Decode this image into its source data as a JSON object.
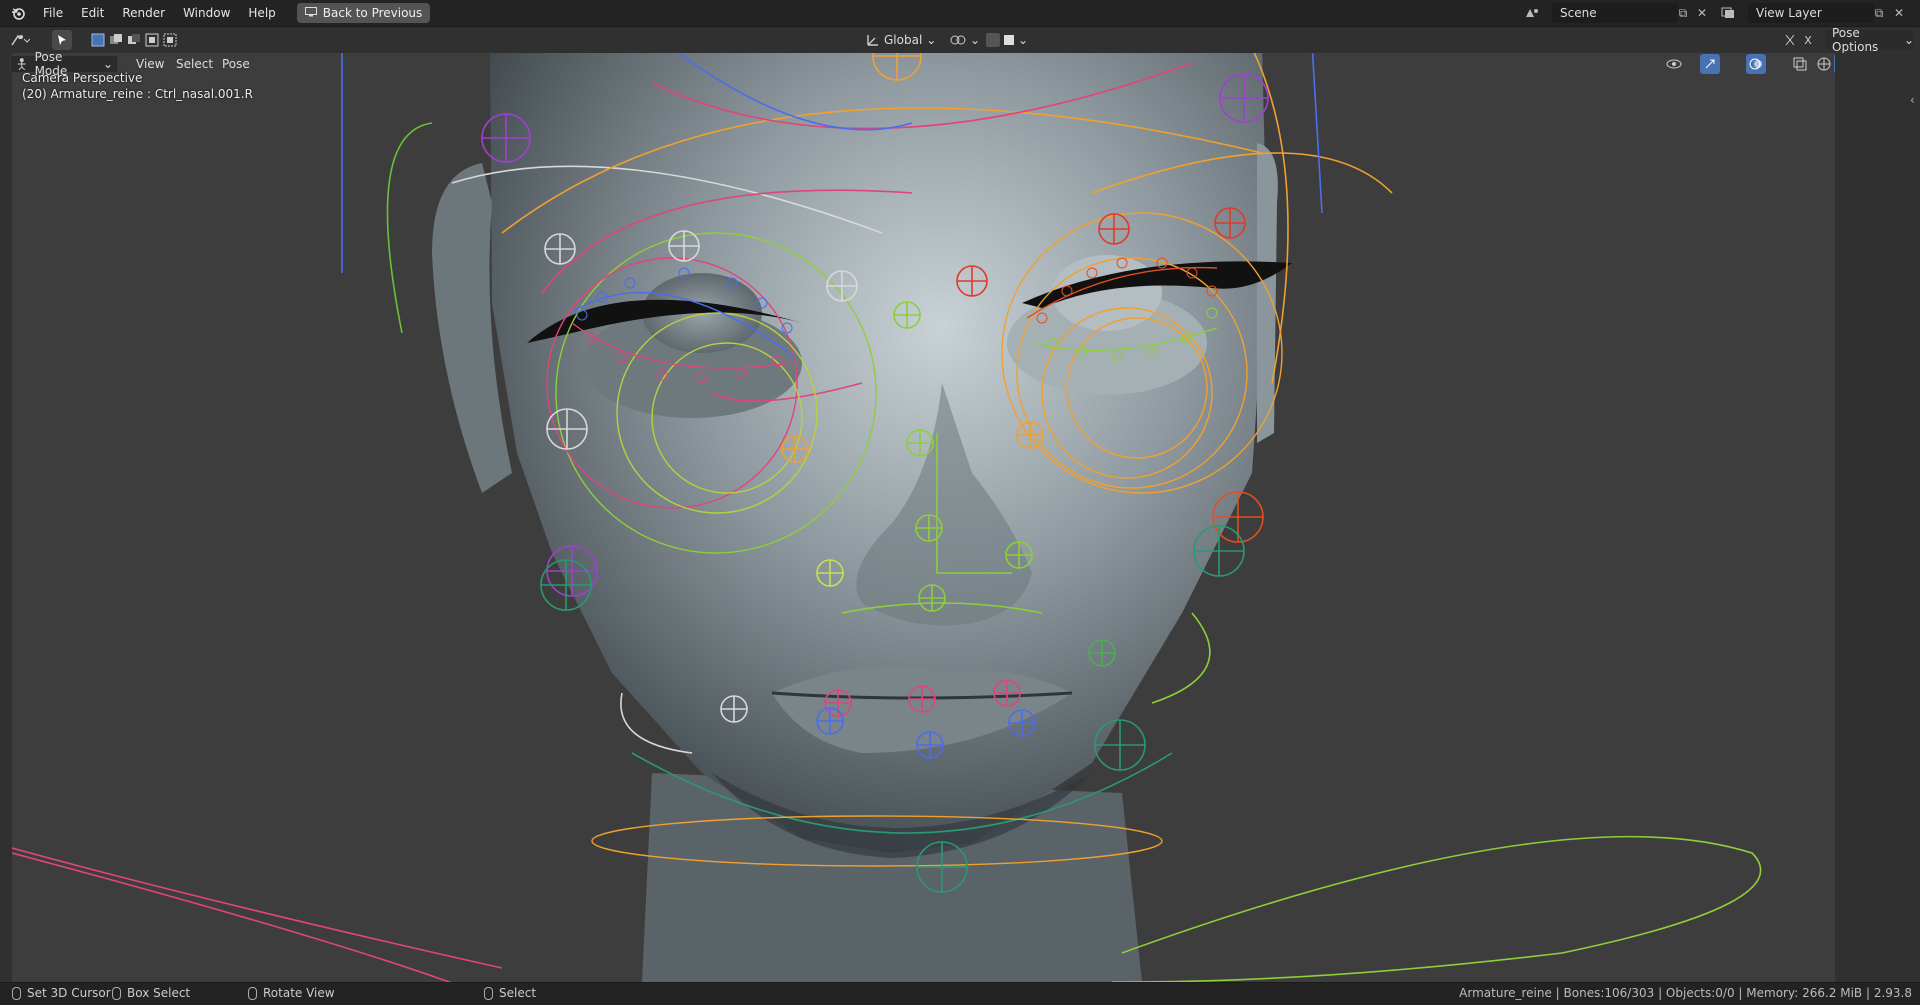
{
  "topbar": {
    "menus": [
      "File",
      "Edit",
      "Render",
      "Window",
      "Help"
    ],
    "back_button": "Back to Previous",
    "scene": "Scene",
    "view_layer": "View Layer"
  },
  "toolheader": {
    "transform_orientation": "Global",
    "pose_options": "Pose Options"
  },
  "viewport_header": {
    "mode": "Pose Mode",
    "menus": [
      "View",
      "Select",
      "Pose"
    ]
  },
  "viewport": {
    "camera_label": "Camera Perspective",
    "object_label": "(20) Armature_reine : Ctrl_nasal.001.R"
  },
  "statusbar": {
    "left_items": [
      "Set 3D Cursor",
      "Box Select",
      "Rotate View",
      "Select"
    ],
    "right_info": "Armature_reine | Bones:106/303 | Objects:0/0 | Memory: 266.2 MiB | 2.93.8"
  },
  "colors": {
    "accent_blue": "#4772b3",
    "bone_pink": "#e0457a",
    "bone_orange": "#f0a030",
    "bone_green": "#8ccf3a",
    "bone_blue": "#4a6df0",
    "bone_red": "#e03a2a",
    "bone_purple": "#a040d0"
  }
}
